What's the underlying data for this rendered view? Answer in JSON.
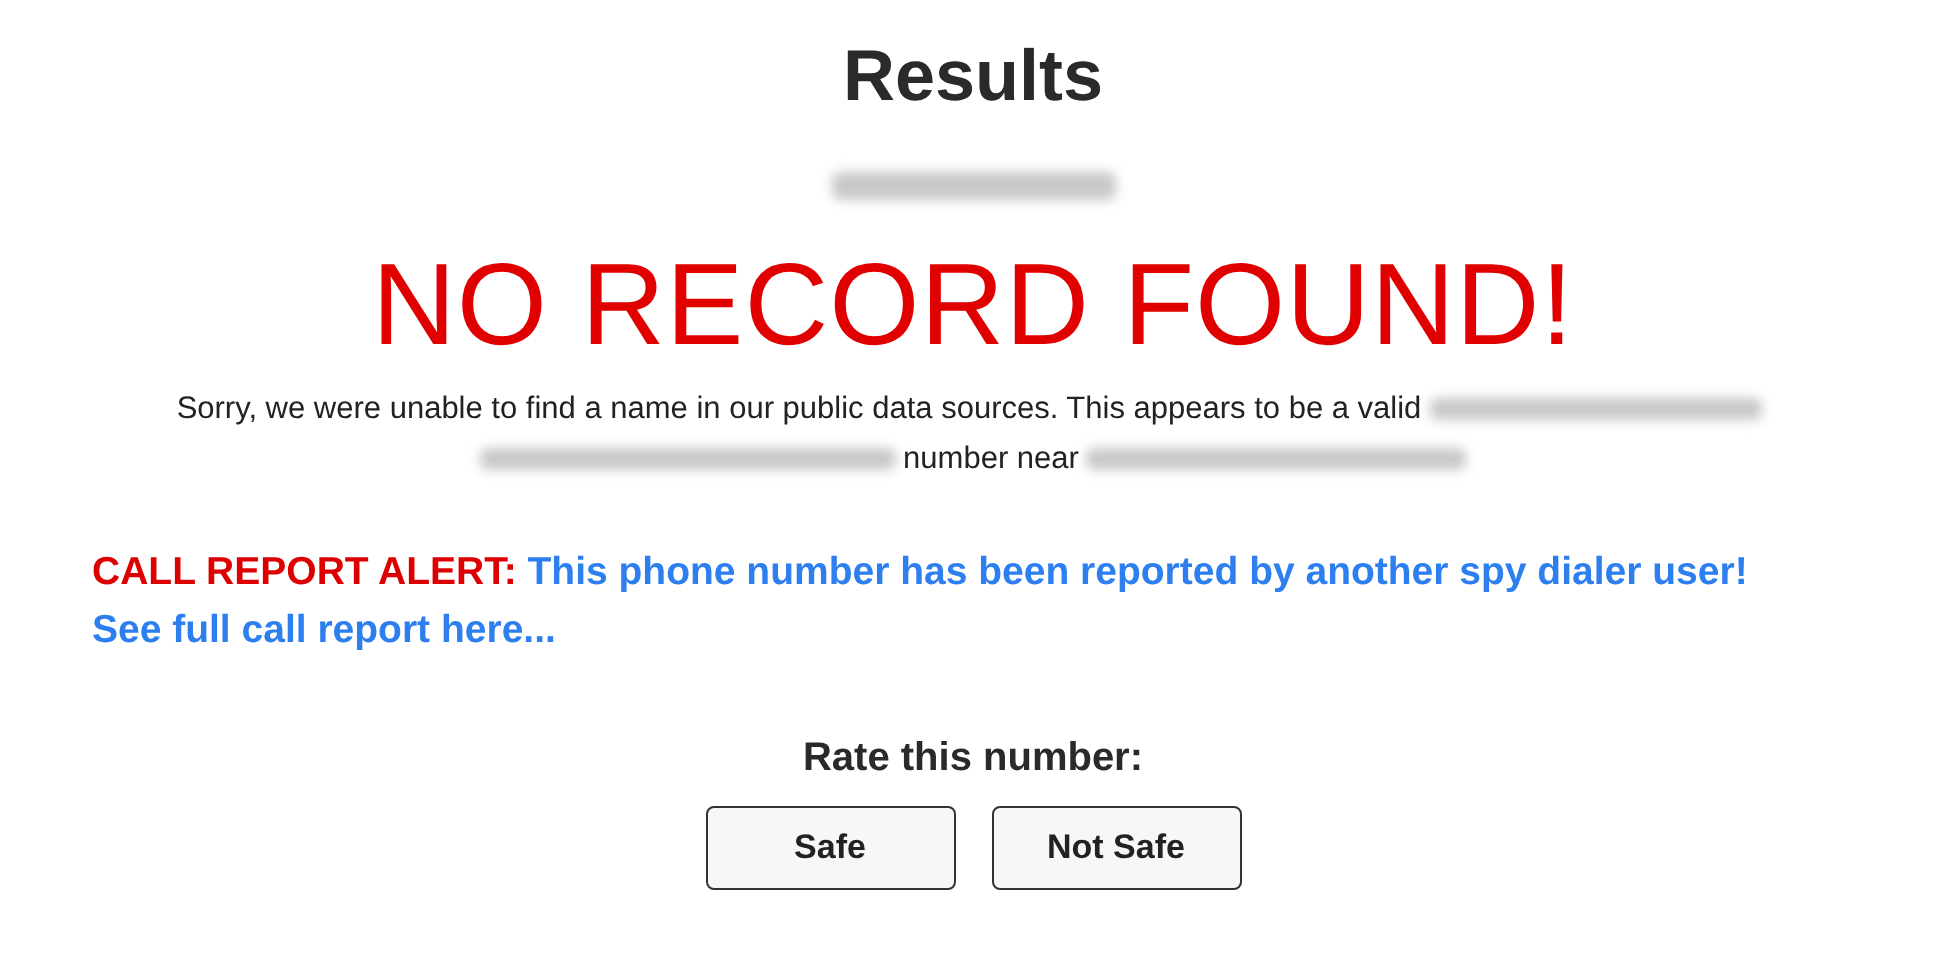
{
  "title": "Results",
  "phone": {
    "kind": "redacted"
  },
  "headline": "NO RECORD FOUND!",
  "message": [
    {
      "kind": "text",
      "text": "Sorry, we were unable to find a name in our public data sources. This appears to be a valid"
    },
    {
      "kind": "redacted"
    },
    {
      "kind": "redacted"
    },
    {
      "kind": "text",
      "text": "number near"
    },
    {
      "kind": "redacted"
    }
  ],
  "alert": {
    "label": "CALL REPORT ALERT:",
    "text": "This phone number has been reported by another spy dialer user!",
    "link": "See full call report here..."
  },
  "rating": {
    "prompt": "Rate this number:",
    "buttons": [
      "Safe",
      "Not Safe"
    ]
  }
}
